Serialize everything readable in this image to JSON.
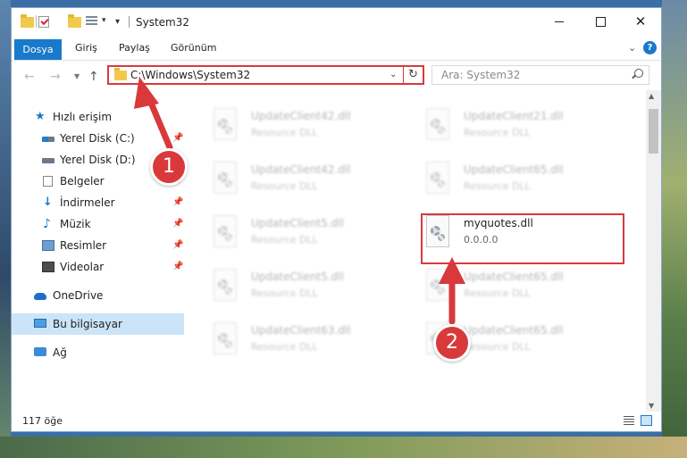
{
  "window": {
    "title": "System32",
    "controls": {
      "minimize_icon": "minimize-icon",
      "maximize_icon": "maximize-icon",
      "close_label": "✕"
    }
  },
  "ribbon": {
    "tabs": [
      {
        "label": "Dosya",
        "active": true
      },
      {
        "label": "Giriş"
      },
      {
        "label": "Paylaş"
      },
      {
        "label": "Görünüm"
      }
    ],
    "help_label": "?"
  },
  "navigation": {
    "back_icon": "←",
    "forward_icon": "→",
    "up_icon": "↑",
    "address": "C:\\Windows\\System32",
    "search_placeholder": "Ara: System32"
  },
  "sidebar": {
    "items": [
      {
        "label": "Hızlı erişim",
        "icon": "star-icon"
      },
      {
        "label": "Yerel Disk (C:)",
        "icon": "drive-icon",
        "pinned": true
      },
      {
        "label": "Yerel Disk (D:)",
        "icon": "drive-icon",
        "pinned": true
      },
      {
        "label": "Belgeler",
        "icon": "document-icon",
        "pinned": true
      },
      {
        "label": "İndirmeler",
        "icon": "download-icon",
        "pinned": true
      },
      {
        "label": "Müzik",
        "icon": "music-icon",
        "pinned": true
      },
      {
        "label": "Resimler",
        "icon": "pictures-icon",
        "pinned": true
      },
      {
        "label": "Videolar",
        "icon": "video-icon",
        "pinned": true
      },
      {
        "label": "OneDrive",
        "icon": "cloud-icon"
      },
      {
        "label": "Bu bilgisayar",
        "icon": "computer-icon",
        "selected": true
      },
      {
        "label": "Ağ",
        "icon": "network-icon"
      }
    ]
  },
  "files": [
    {
      "name": "UpdateClient42.dll",
      "subtitle": "Resource DLL"
    },
    {
      "name": "UpdateClient21.dll",
      "subtitle": "Resource DLL"
    },
    {
      "name": "UpdateClient42.dll",
      "subtitle": "Resource DLL"
    },
    {
      "name": "UpdateClient65.dll",
      "subtitle": "Resource DLL"
    },
    {
      "name": "UpdateClient5.dll",
      "subtitle": "Resource DLL"
    },
    {
      "name": "myquotes.dll",
      "subtitle": "0.0.0.0",
      "highlighted": true
    },
    {
      "name": "UpdateClient5.dll",
      "subtitle": "Resource DLL"
    },
    {
      "name": "UpdateClient65.dll",
      "subtitle": "Resource DLL"
    },
    {
      "name": "UpdateClient63.dll",
      "subtitle": "Resource DLL"
    },
    {
      "name": "UpdateClient65.dll",
      "subtitle": "Resource DLL"
    }
  ],
  "status": {
    "item_count": "117 öğe"
  },
  "annotations": [
    {
      "number": "1",
      "target": "address-bar"
    },
    {
      "number": "2",
      "target": "myquotes.dll"
    }
  ],
  "colors": {
    "accent": "#1979ca",
    "annotation": "#d9393b",
    "selection": "#cce4f7"
  }
}
